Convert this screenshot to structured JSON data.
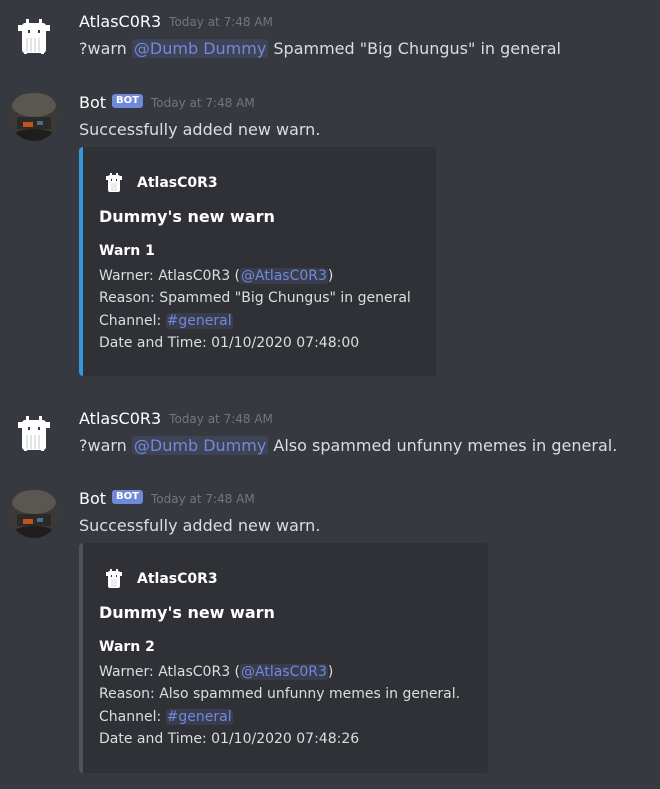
{
  "colors": {
    "background": "#36393f",
    "embed_background": "#2f3136",
    "mention": "#7289da",
    "bot_tag": "#7289da",
    "embed_accent_1": "#3498db",
    "embed_accent_2": "#4f545c"
  },
  "messages": [
    {
      "author": "AtlasC0R3",
      "timestamp": "Today at 7:48 AM",
      "content_prefix": "?warn ",
      "mention": "@Dumb Dummy",
      "content_suffix": " Spammed \"Big Chungus\" in general",
      "avatar_icon": "trash-can-avatar-icon"
    },
    {
      "author": "Bot",
      "bot_tag": "BOT",
      "timestamp": "Today at 7:48 AM",
      "content": "Successfully added new warn.",
      "avatar_icon": "bot-photo-avatar-icon",
      "embed": {
        "author": "AtlasC0R3",
        "title": "Dummy's new warn",
        "field_name": "Warn 1",
        "warner_label": "Warner: AtlasC0R3 (",
        "warner_mention": "@AtlasC0R3",
        "warner_close": ")",
        "reason": "Reason: Spammed \"Big Chungus\" in general",
        "channel_label": "Channel: ",
        "channel_mention": "#general",
        "datetime": "Date and Time: 01/10/2020 07:48:00"
      }
    },
    {
      "author": "AtlasC0R3",
      "timestamp": "Today at 7:48 AM",
      "content_prefix": "?warn ",
      "mention": "@Dumb Dummy",
      "content_suffix": " Also spammed unfunny memes in general.",
      "avatar_icon": "trash-can-avatar-icon"
    },
    {
      "author": "Bot",
      "bot_tag": "BOT",
      "timestamp": "Today at 7:48 AM",
      "content": "Successfully added new warn.",
      "avatar_icon": "bot-photo-avatar-icon",
      "embed": {
        "author": "AtlasC0R3",
        "title": "Dummy's new warn",
        "field_name": "Warn 2",
        "warner_label": "Warner: AtlasC0R3 (",
        "warner_mention": "@AtlasC0R3",
        "warner_close": ")",
        "reason": "Reason: Also spammed unfunny memes in general.",
        "channel_label": "Channel: ",
        "channel_mention": "#general",
        "datetime": "Date and Time: 01/10/2020 07:48:26"
      }
    }
  ]
}
